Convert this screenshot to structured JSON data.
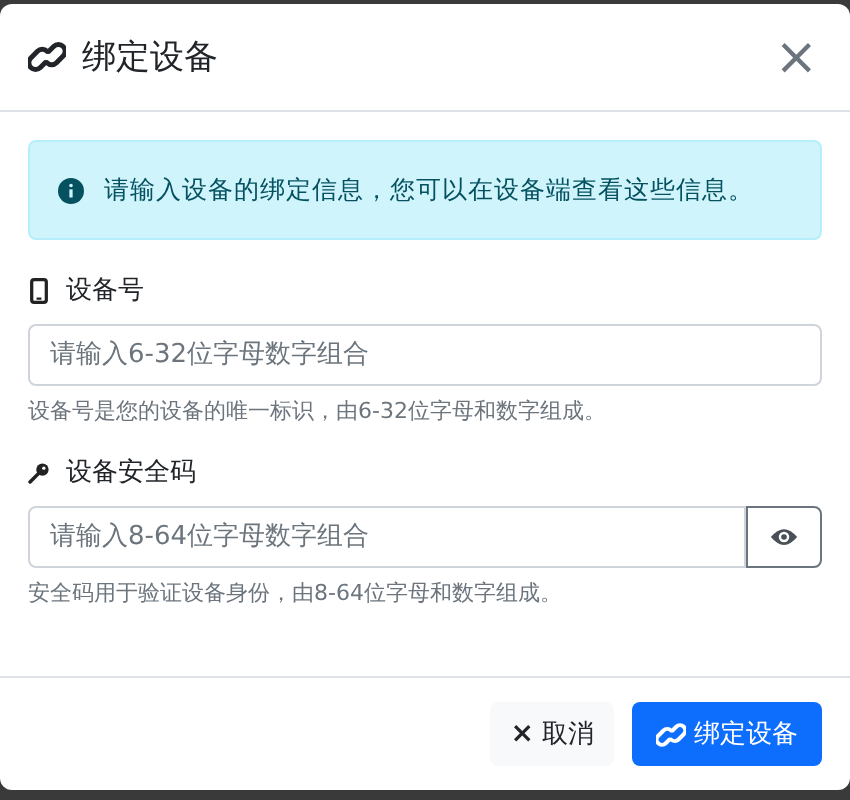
{
  "dialog": {
    "title": "绑定设备",
    "close_symbol": "×"
  },
  "alert": {
    "text": "请输入设备的绑定信息，您可以在设备端查看这些信息。"
  },
  "fields": [
    {
      "kind": "text",
      "label": "设备号",
      "placeholder": "请输入6-32位字母数字组合",
      "help": "设备号是您的设备的唯一标识，由6-32位字母和数字组成。"
    },
    {
      "kind": "password",
      "label": "设备安全码",
      "placeholder": "请输入8-64位字母数字组合",
      "help": "安全码用于验证设备身份，由8-64位字母和数字组成。"
    }
  ],
  "buttons": [
    {
      "kind": "secondary",
      "icon": "×",
      "label": "取消"
    },
    {
      "kind": "primary",
      "label": "绑定设备"
    }
  ]
}
